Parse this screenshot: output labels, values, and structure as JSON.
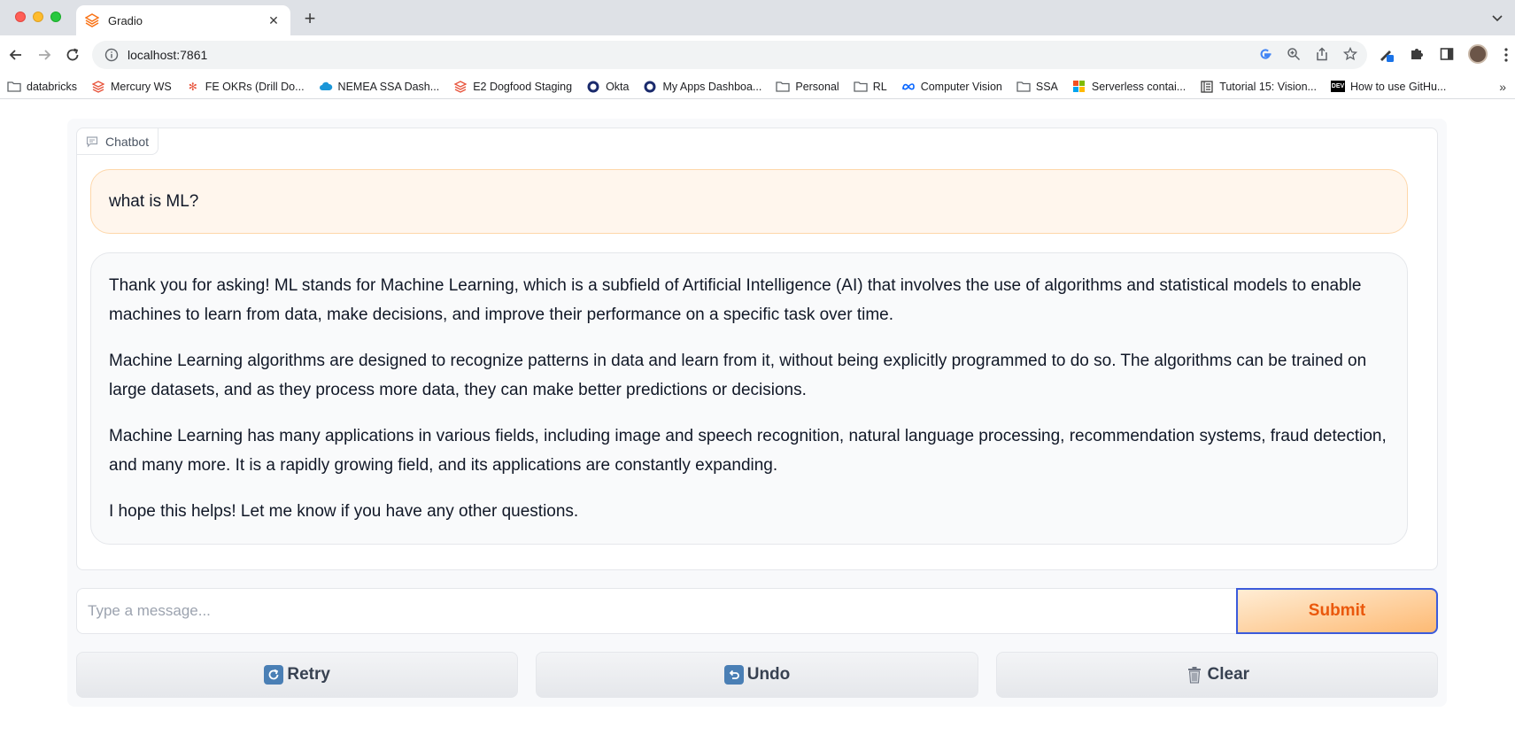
{
  "browser": {
    "tab_title": "Gradio",
    "url": "localhost:7861",
    "bookmarks": [
      {
        "label": "databricks",
        "icon": "folder-icon"
      },
      {
        "label": "Mercury WS",
        "icon": "databricks-icon"
      },
      {
        "label": "FE OKRs (Drill Do...",
        "icon": "asterisk-icon"
      },
      {
        "label": "NEMEA SSA Dash...",
        "icon": "cloud-icon"
      },
      {
        "label": "E2 Dogfood Staging",
        "icon": "databricks-icon"
      },
      {
        "label": "Okta",
        "icon": "okta-icon"
      },
      {
        "label": "My Apps Dashboa...",
        "icon": "okta-icon"
      },
      {
        "label": "Personal",
        "icon": "folder-icon"
      },
      {
        "label": "RL",
        "icon": "folder-icon"
      },
      {
        "label": "Computer Vision",
        "icon": "meta-icon"
      },
      {
        "label": "SSA",
        "icon": "folder-icon"
      },
      {
        "label": "Serverless contai...",
        "icon": "microsoft-icon"
      },
      {
        "label": "Tutorial 15: Vision...",
        "icon": "doc-icon"
      },
      {
        "label": "How to use GitHu...",
        "icon": "dev-icon"
      }
    ],
    "dev_badge": "DEV"
  },
  "chatbot": {
    "label": "Chatbot",
    "user_message": "what is ML?",
    "bot_paragraphs": [
      "Thank you for asking! ML stands for Machine Learning, which is a subfield of Artificial Intelligence (AI) that involves the use of algorithms and statistical models to enable machines to learn from data, make decisions, and improve their performance on a specific task over time.",
      "Machine Learning algorithms are designed to recognize patterns in data and learn from it, without being explicitly programmed to do so. The algorithms can be trained on large datasets, and as they process more data, they can make better predictions or decisions.",
      "Machine Learning has many applications in various fields, including image and speech recognition, natural language processing, recommendation systems, fraud detection, and many more. It is a rapidly growing field, and its applications are constantly expanding.",
      "I hope this helps! Let me know if you have any other questions."
    ]
  },
  "input": {
    "placeholder": "Type a message...",
    "value": "",
    "submit_label": "Submit"
  },
  "actions": {
    "retry_label": "Retry",
    "undo_label": "Undo",
    "clear_label": "Clear"
  },
  "colors": {
    "accent": "#ea580c",
    "user_bubble": "#fff6ed",
    "bot_bubble": "#f9fafb"
  }
}
